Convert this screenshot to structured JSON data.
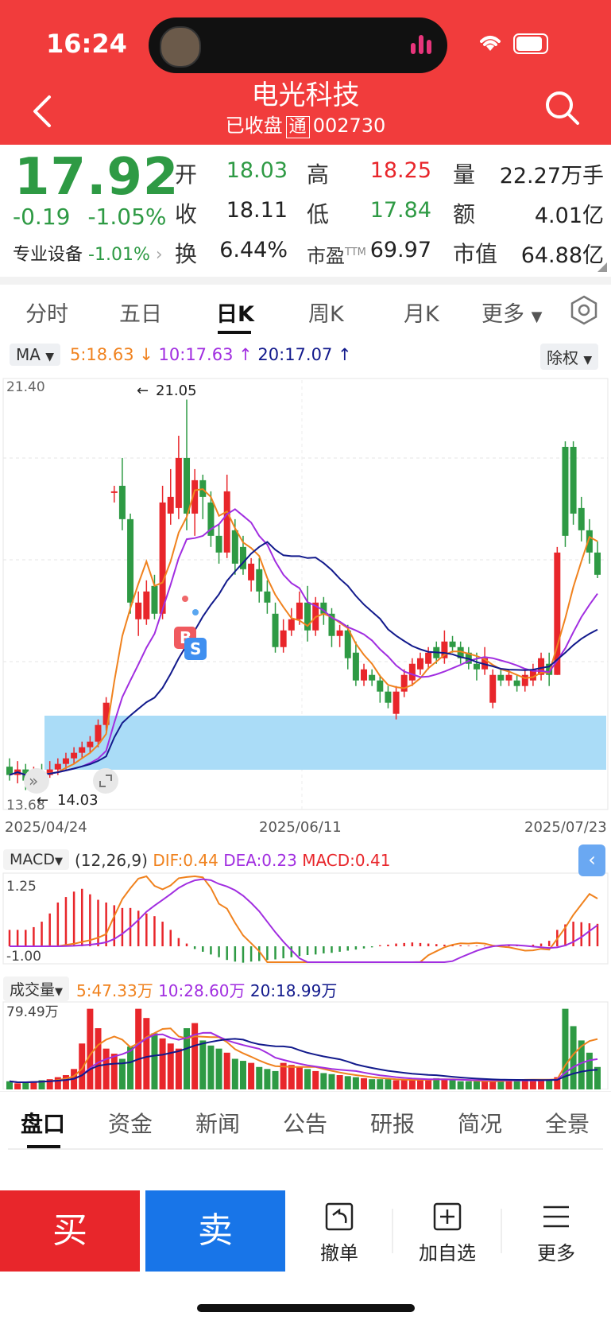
{
  "status_bar": {
    "time": "16:24"
  },
  "header": {
    "title": "电光科技",
    "status": "已收盘",
    "tong": "通",
    "code": "002730"
  },
  "quote": {
    "price": "17.92",
    "change": "-0.19",
    "change_pct": "-1.05%",
    "sector": "专业设备",
    "sector_pct": "-1.01%",
    "fields": [
      {
        "label": "开",
        "value": "18.03",
        "color": "#2e9a44"
      },
      {
        "label": "高",
        "value": "18.25",
        "color": "#e8262b"
      },
      {
        "label": "量",
        "value": "22.27万手",
        "color": "#222222"
      },
      {
        "label": "收",
        "value": "18.11",
        "color": "#222222"
      },
      {
        "label": "低",
        "value": "17.84",
        "color": "#2e9a44"
      },
      {
        "label": "额",
        "value": "4.01亿",
        "color": "#222222"
      },
      {
        "label": "换",
        "value": "6.44%",
        "color": "#222222"
      },
      {
        "label": "市盈™",
        "value": "69.97",
        "color": "#222222"
      },
      {
        "label": "市值",
        "value": "64.88亿",
        "color": "#222222"
      }
    ]
  },
  "chart_tabs": [
    "分时",
    "五日",
    "日K",
    "周K",
    "月K",
    "更多"
  ],
  "active_chart_tab": "日K",
  "ma_bar": {
    "indicator": "MA",
    "ma5": "5:18.63",
    "ma10": "10:17.63",
    "ma20": "20:17.07",
    "adjust": "除权"
  },
  "kline": {
    "y_max_label": "21.40",
    "y_min_label": "13.68",
    "high_marker": "21.05",
    "low_marker": "14.03",
    "dates": [
      "2025/04/24",
      "2025/06/11",
      "2025/07/23"
    ],
    "badges": {
      "b": "B",
      "s": "S"
    }
  },
  "macd": {
    "name": "MACD",
    "params": "(12,26,9)",
    "dif": "DIF:0.44",
    "dea": "DEA:0.23",
    "macd": "MACD:0.41",
    "y_top": "1.25",
    "y_bottom": "-1.00"
  },
  "volume": {
    "name": "成交量",
    "ma5": "5:47.33万",
    "ma10": "10:28.60万",
    "ma20": "20:18.99万",
    "y_top": "79.49万"
  },
  "colors": {
    "up": "#e8262b",
    "down": "#2e9a44",
    "ma5": "#f0821e",
    "ma10": "#a12ee0",
    "ma20": "#121a8c",
    "header": "#f13c3c"
  },
  "chart_data": {
    "type": "candlestick",
    "title": "",
    "x_range": [
      "2025/04/24",
      "2025/07/23"
    ],
    "ylim": [
      13.68,
      21.4
    ],
    "candles": [
      {
        "open": 14.45,
        "close": 14.3,
        "high": 14.6,
        "low": 14.2
      },
      {
        "open": 14.3,
        "close": 14.4,
        "high": 14.55,
        "low": 14.15
      },
      {
        "open": 14.4,
        "close": 14.2,
        "high": 14.5,
        "low": 14.03
      },
      {
        "open": 14.25,
        "close": 14.35,
        "high": 14.45,
        "low": 14.1
      },
      {
        "open": 14.35,
        "close": 14.3,
        "high": 14.5,
        "low": 14.2
      },
      {
        "open": 14.3,
        "close": 14.4,
        "high": 14.55,
        "low": 14.25
      },
      {
        "open": 14.4,
        "close": 14.5,
        "high": 14.6,
        "low": 14.3
      },
      {
        "open": 14.5,
        "close": 14.6,
        "high": 14.7,
        "low": 14.4
      },
      {
        "open": 14.6,
        "close": 14.7,
        "high": 14.8,
        "low": 14.5
      },
      {
        "open": 14.7,
        "close": 14.8,
        "high": 14.9,
        "low": 14.6
      },
      {
        "open": 14.8,
        "close": 14.9,
        "high": 15.0,
        "low": 14.7
      },
      {
        "open": 14.9,
        "close": 15.2,
        "high": 15.3,
        "low": 14.8
      },
      {
        "open": 15.2,
        "close": 15.6,
        "high": 15.7,
        "low": 15.1
      },
      {
        "open": 19.4,
        "close": 19.4,
        "high": 19.5,
        "low": 19.2
      },
      {
        "open": 19.5,
        "close": 18.9,
        "high": 20.0,
        "low": 18.7
      },
      {
        "open": 18.9,
        "close": 17.4,
        "high": 19.0,
        "low": 17.2
      },
      {
        "open": 17.1,
        "close": 17.4,
        "high": 17.6,
        "low": 16.8
      },
      {
        "open": 17.1,
        "close": 17.6,
        "high": 17.8,
        "low": 17.0
      },
      {
        "open": 17.7,
        "close": 17.2,
        "high": 17.9,
        "low": 17.1
      },
      {
        "open": 17.2,
        "close": 19.2,
        "high": 19.5,
        "low": 17.1
      },
      {
        "open": 19.0,
        "close": 19.3,
        "high": 19.8,
        "low": 18.8
      },
      {
        "open": 19.1,
        "close": 20.0,
        "high": 20.4,
        "low": 18.9
      },
      {
        "open": 20.0,
        "close": 19.0,
        "high": 21.05,
        "low": 18.7
      },
      {
        "open": 19.0,
        "close": 19.6,
        "high": 19.8,
        "low": 18.6
      },
      {
        "open": 19.6,
        "close": 19.3,
        "high": 19.7,
        "low": 18.9
      },
      {
        "open": 19.2,
        "close": 18.6,
        "high": 19.4,
        "low": 18.4
      },
      {
        "open": 18.6,
        "close": 18.3,
        "high": 18.8,
        "low": 18.1
      },
      {
        "open": 18.3,
        "close": 19.4,
        "high": 19.7,
        "low": 18.2
      },
      {
        "open": 18.7,
        "close": 18.1,
        "high": 18.9,
        "low": 17.9
      },
      {
        "open": 18.4,
        "close": 18.0,
        "high": 18.6,
        "low": 17.9
      },
      {
        "open": 17.8,
        "close": 18.1,
        "high": 18.2,
        "low": 17.6
      },
      {
        "open": 18.0,
        "close": 17.6,
        "high": 18.2,
        "low": 17.4
      },
      {
        "open": 17.6,
        "close": 17.4,
        "high": 17.8,
        "low": 17.2
      },
      {
        "open": 17.2,
        "close": 16.6,
        "high": 17.4,
        "low": 16.5
      },
      {
        "open": 16.6,
        "close": 16.9,
        "high": 17.1,
        "low": 16.5
      },
      {
        "open": 16.9,
        "close": 17.1,
        "high": 17.3,
        "low": 16.8
      },
      {
        "open": 17.1,
        "close": 17.4,
        "high": 17.6,
        "low": 17.0
      },
      {
        "open": 17.4,
        "close": 16.9,
        "high": 17.7,
        "low": 16.7
      },
      {
        "open": 16.9,
        "close": 17.4,
        "high": 17.5,
        "low": 16.8
      },
      {
        "open": 17.4,
        "close": 17.2,
        "high": 17.5,
        "low": 17.0
      },
      {
        "open": 17.2,
        "close": 16.8,
        "high": 17.3,
        "low": 16.6
      },
      {
        "open": 16.8,
        "close": 16.9,
        "high": 17.0,
        "low": 16.6
      },
      {
        "open": 16.9,
        "close": 16.4,
        "high": 17.0,
        "low": 16.2
      },
      {
        "open": 16.5,
        "close": 16.0,
        "high": 16.7,
        "low": 15.9
      },
      {
        "open": 16.0,
        "close": 16.2,
        "high": 16.3,
        "low": 15.9
      },
      {
        "open": 16.1,
        "close": 16.0,
        "high": 16.2,
        "low": 15.9
      },
      {
        "open": 16.0,
        "close": 15.8,
        "high": 16.1,
        "low": 15.6
      },
      {
        "open": 15.8,
        "close": 15.6,
        "high": 15.9,
        "low": 15.5
      },
      {
        "open": 15.4,
        "close": 15.8,
        "high": 15.9,
        "low": 15.3
      },
      {
        "open": 15.8,
        "close": 16.1,
        "high": 16.2,
        "low": 15.7
      },
      {
        "open": 16.0,
        "close": 16.3,
        "high": 16.4,
        "low": 15.9
      },
      {
        "open": 16.2,
        "close": 16.4,
        "high": 16.5,
        "low": 16.1
      },
      {
        "open": 16.3,
        "close": 16.5,
        "high": 16.6,
        "low": 16.2
      },
      {
        "open": 16.6,
        "close": 16.4,
        "high": 16.7,
        "low": 16.3
      },
      {
        "open": 16.4,
        "close": 16.7,
        "high": 16.9,
        "low": 16.3
      },
      {
        "open": 16.7,
        "close": 16.6,
        "high": 16.8,
        "low": 16.5
      },
      {
        "open": 16.6,
        "close": 16.4,
        "high": 16.7,
        "low": 16.3
      },
      {
        "open": 16.5,
        "close": 16.3,
        "high": 16.6,
        "low": 16.2
      },
      {
        "open": 16.3,
        "close": 16.2,
        "high": 16.5,
        "low": 16.0
      },
      {
        "open": 16.2,
        "close": 16.4,
        "high": 16.6,
        "low": 16.1
      },
      {
        "open": 15.6,
        "close": 16.1,
        "high": 16.2,
        "low": 15.5
      },
      {
        "open": 16.1,
        "close": 16.0,
        "high": 16.2,
        "low": 15.9
      },
      {
        "open": 16.0,
        "close": 16.1,
        "high": 16.2,
        "low": 15.9
      },
      {
        "open": 16.0,
        "close": 15.9,
        "high": 16.1,
        "low": 15.8
      },
      {
        "open": 15.9,
        "close": 16.1,
        "high": 16.2,
        "low": 15.8
      },
      {
        "open": 16.0,
        "close": 16.2,
        "high": 16.3,
        "low": 15.9
      },
      {
        "open": 16.1,
        "close": 16.4,
        "high": 16.5,
        "low": 16.0
      },
      {
        "open": 16.3,
        "close": 16.1,
        "high": 16.5,
        "low": 15.9
      },
      {
        "open": 16.1,
        "close": 18.3,
        "high": 18.4,
        "low": 16.1
      },
      {
        "open": 20.2,
        "close": 18.6,
        "high": 20.3,
        "low": 18.4
      },
      {
        "open": 20.2,
        "close": 19.0,
        "high": 20.3,
        "low": 18.8
      },
      {
        "open": 19.1,
        "close": 18.7,
        "high": 19.3,
        "low": 18.5
      },
      {
        "open": 18.7,
        "close": 18.3,
        "high": 18.9,
        "low": 18.1
      },
      {
        "open": 18.3,
        "close": 17.9,
        "high": 18.5,
        "low": 17.84
      }
    ],
    "macd_hist": [
      0.3,
      0.3,
      0.3,
      0.35,
      0.45,
      0.6,
      0.8,
      0.9,
      1.0,
      1.05,
      0.95,
      0.85,
      0.8,
      0.75,
      0.7,
      0.7,
      0.65,
      0.6,
      0.55,
      0.45,
      0.3,
      0.15,
      0.05,
      -0.05,
      -0.1,
      -0.15,
      -0.2,
      -0.25,
      -0.28,
      -0.3,
      -0.28,
      -0.27,
      -0.25,
      -0.24,
      -0.22,
      -0.2,
      -0.18,
      -0.16,
      -0.15,
      -0.13,
      -0.12,
      -0.1,
      -0.08,
      -0.06,
      -0.04,
      -0.02,
      0.02,
      0.03,
      0.05,
      0.06,
      0.07,
      0.06,
      0.05,
      0.04,
      0.03,
      0.02,
      0.02,
      0.01,
      0.01,
      0.01,
      0.01,
      0.01,
      0.01,
      0.02,
      0.02,
      0.03,
      0.05,
      0.1,
      0.3,
      0.4,
      0.45,
      0.44,
      0.42,
      0.41
    ],
    "volume_wan": [
      8,
      6,
      7,
      8,
      9,
      10,
      12,
      14,
      20,
      45,
      79,
      60,
      40,
      35,
      30,
      42,
      79,
      70,
      55,
      50,
      45,
      40,
      60,
      65,
      48,
      43,
      40,
      36,
      30,
      28,
      26,
      22,
      20,
      18,
      26,
      24,
      22,
      20,
      18,
      16,
      15,
      14,
      13,
      12,
      11,
      10,
      10,
      10,
      9,
      9,
      9,
      10,
      10,
      11,
      10,
      9,
      8,
      8,
      8,
      8,
      8,
      9,
      10,
      10,
      10,
      9,
      9,
      10,
      12,
      79,
      62,
      48,
      36,
      22
    ]
  }
}
